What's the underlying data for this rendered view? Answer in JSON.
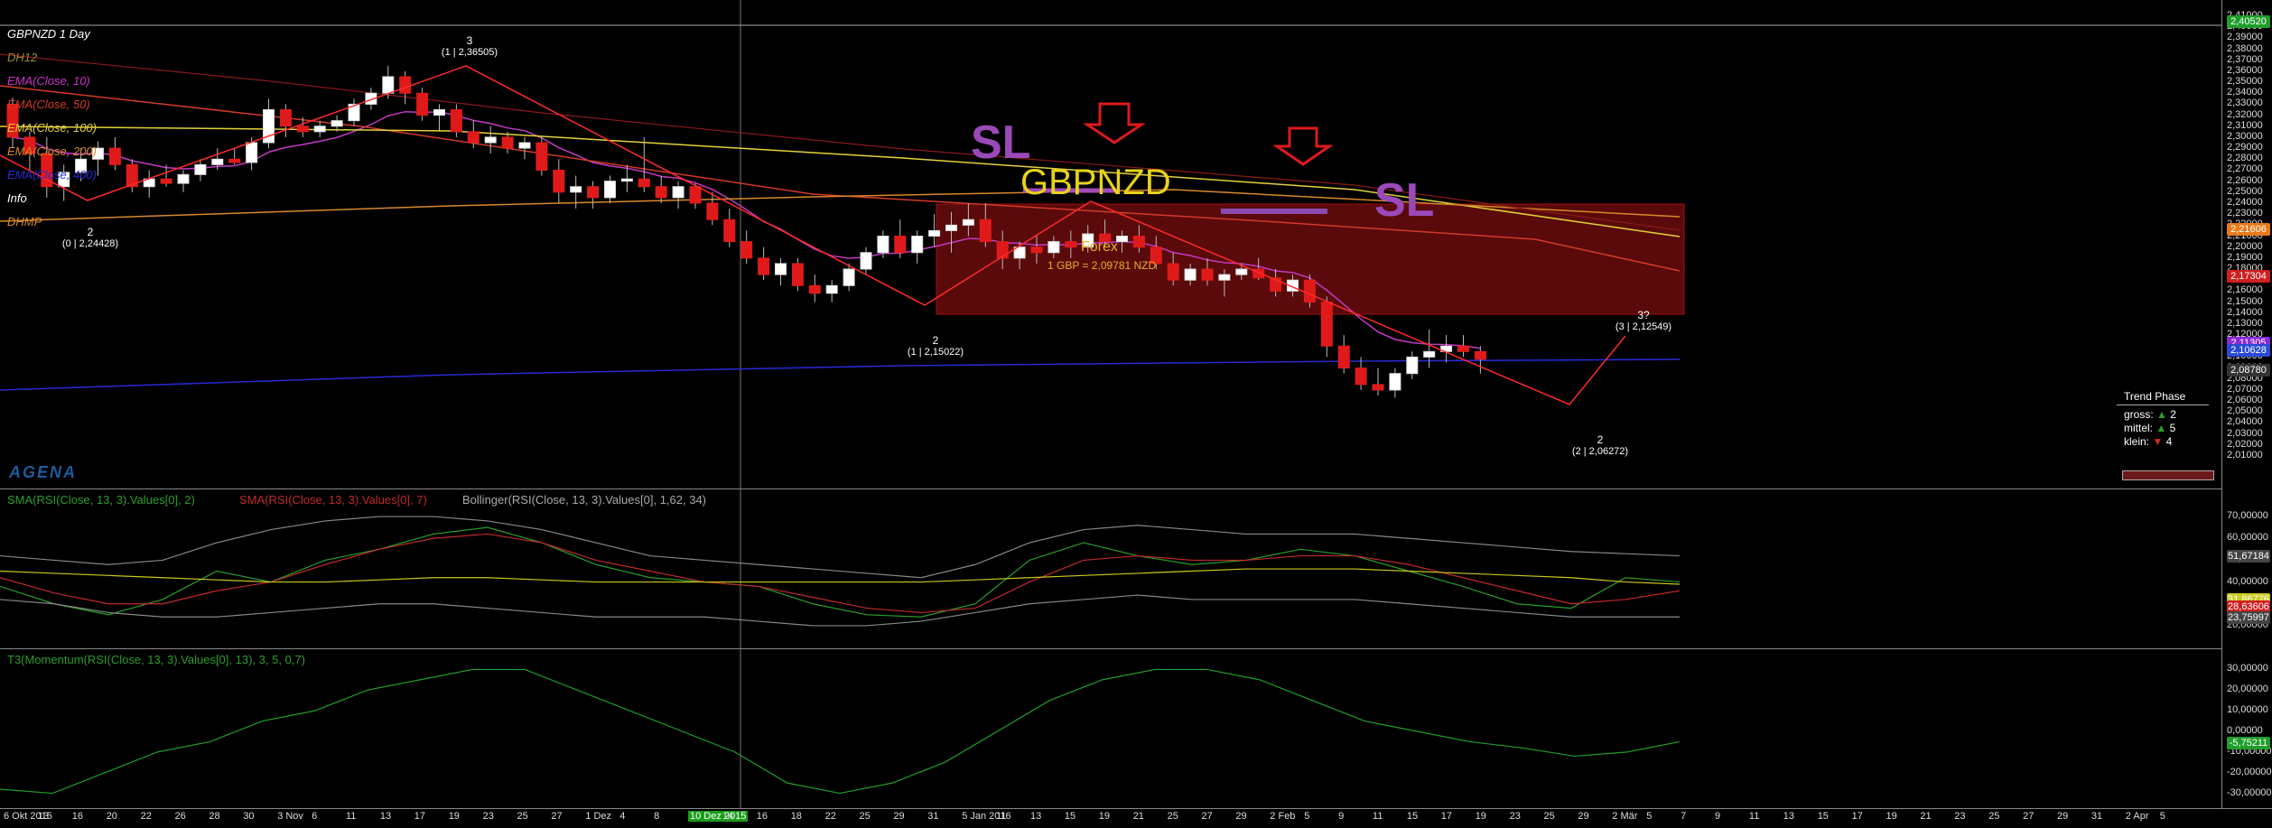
{
  "chart": {
    "symbol_title": "GBPNZD 1 Day",
    "indicators": [
      {
        "label": "DH12",
        "color": "#8f8f2a"
      },
      {
        "label": "EMA(Close, 10)",
        "color": "#cc33cc"
      },
      {
        "label": "EMA(Close, 50)",
        "color": "#d23a2a"
      },
      {
        "label": "EMA(Close, 100)",
        "color": "#e2d23a"
      },
      {
        "label": "EMA(Close, 200)",
        "color": "#d7892a"
      },
      {
        "label": "EMA(Close, 400)",
        "color": "#2a2ad6"
      },
      {
        "label": "Info",
        "color": "#ffffff"
      },
      {
        "label": "DHMP",
        "color": "#d7892a"
      }
    ],
    "annotations": {
      "sl_left": "SL",
      "sl_right": "SL",
      "symbol_big": "GBPNZD",
      "forex_label": "Forex",
      "rate_label": "1 GBP = 2,09781 NZD",
      "dash": "——"
    },
    "waves": [
      {
        "num": "3",
        "detail": "(1 | 2,36505)"
      },
      {
        "num": "2",
        "detail": "(0 | 2,24428)"
      },
      {
        "num": "2",
        "detail": "(1 | 2,15022)"
      },
      {
        "num": "3?",
        "detail": "(3 | 2,12549)"
      },
      {
        "num": "2",
        "detail": "(2 | 2,06272)"
      }
    ],
    "trend_phase": {
      "title": "Trend Phase",
      "gross": "gross:",
      "gross_val": "2",
      "mittel": "mittel:",
      "mittel_val": "5",
      "klein": "klein:",
      "klein_val": "4"
    },
    "logo": "AGENA",
    "price_axis": [
      "2,41000",
      "2,40000",
      "2,39000",
      "2,38000",
      "2,37000",
      "2,36000",
      "2,35000",
      "2,34000",
      "2,33000",
      "2,32000",
      "2,31000",
      "2,30000",
      "2,29000",
      "2,28000",
      "2,27000",
      "2,26000",
      "2,25000",
      "2,24000",
      "2,23000",
      "2,22000",
      "2,21000",
      "2,20000",
      "2,19000",
      "2,18000",
      "2,17000",
      "2,16000",
      "2,15000",
      "2,14000",
      "2,13000",
      "2,12000",
      "2,11000",
      "2,10000",
      "2,09000",
      "2,08000",
      "2,07000",
      "2,06000",
      "2,05000",
      "2,04000",
      "2,03000",
      "2,02000",
      "2,01000"
    ],
    "price_badges": [
      {
        "text": "2,40520",
        "color": "#1f9e2a"
      },
      {
        "text": "2,21606",
        "color": "#e87a1a"
      },
      {
        "text": "2,17304",
        "color": "#d01f1f"
      },
      {
        "text": "2,11305",
        "color": "#8a2ad6"
      },
      {
        "text": "2,10628",
        "color": "#2a4ad6"
      },
      {
        "text": "2,08780",
        "color": "#333333"
      }
    ]
  },
  "rsi_pane": {
    "titles": [
      {
        "label": "SMA(RSI(Close, 13, 3).Values[0], 2)",
        "color": "#2a9e2a"
      },
      {
        "label": "SMA(RSI(Close, 13, 3).Values[0], 7)",
        "color": "#c02a2a"
      },
      {
        "label": "Bollinger(RSI(Close, 13, 3).Values[0], 1,62, 34)",
        "color": "#aaaaaa"
      }
    ],
    "axis": [
      "70,00000",
      "60,00000",
      "50,00000",
      "40,00000",
      "30,00000",
      "20,00000"
    ],
    "badges": [
      {
        "text": "51,67184",
        "color": "#444444"
      },
      {
        "text": "31,86776",
        "color": "#cccc22"
      },
      {
        "text": "28,63606",
        "color": "#d01f1f"
      },
      {
        "text": "23,75997",
        "color": "#444444"
      }
    ]
  },
  "momentum_pane": {
    "title": "T3(Momentum(RSI(Close, 13, 3).Values[0], 13), 3, 5, 0,7)",
    "title_color": "#2a9e2a",
    "axis": [
      "30,00000",
      "20,00000",
      "10,00000",
      "0,00000",
      "-10,00000",
      "-20,00000",
      "-30,00000"
    ],
    "badge": {
      "text": "-5,75211",
      "color": "#1f9e2a"
    }
  },
  "time_axis": {
    "labels": [
      "6 Okt 2015",
      "13",
      "16",
      "20",
      "22",
      "26",
      "28",
      "30",
      "3 Nov",
      "6",
      "11",
      "13",
      "17",
      "19",
      "23",
      "25",
      "27",
      "1 Dez",
      "4",
      "8",
      "10 Dez 2015",
      "14",
      "16",
      "18",
      "22",
      "25",
      "29",
      "31",
      "5 Jan 2016",
      "11",
      "13",
      "15",
      "19",
      "21",
      "25",
      "27",
      "29",
      "2 Feb",
      "5",
      "9",
      "11",
      "15",
      "17",
      "19",
      "23",
      "25",
      "29",
      "2 Mär",
      "5",
      "7",
      "9",
      "11",
      "13",
      "15",
      "17",
      "19",
      "21",
      "23",
      "25",
      "27",
      "29",
      "31",
      "2 Apr",
      "5"
    ],
    "highlight": "10 Dez 2015"
  },
  "candles": [
    {
      "o": 2.33,
      "h": 2.336,
      "l": 2.29,
      "c": 2.3
    },
    {
      "o": 2.3,
      "h": 2.305,
      "l": 2.27,
      "c": 2.285
    },
    {
      "o": 2.285,
      "h": 2.3,
      "l": 2.245,
      "c": 2.255
    },
    {
      "o": 2.255,
      "h": 2.275,
      "l": 2.242,
      "c": 2.268
    },
    {
      "o": 2.268,
      "h": 2.29,
      "l": 2.26,
      "c": 2.28
    },
    {
      "o": 2.28,
      "h": 2.296,
      "l": 2.265,
      "c": 2.29
    },
    {
      "o": 2.29,
      "h": 2.3,
      "l": 2.27,
      "c": 2.275
    },
    {
      "o": 2.275,
      "h": 2.28,
      "l": 2.25,
      "c": 2.255
    },
    {
      "o": 2.255,
      "h": 2.27,
      "l": 2.245,
      "c": 2.262
    },
    {
      "o": 2.262,
      "h": 2.275,
      "l": 2.255,
      "c": 2.258
    },
    {
      "o": 2.258,
      "h": 2.27,
      "l": 2.25,
      "c": 2.266
    },
    {
      "o": 2.266,
      "h": 2.28,
      "l": 2.26,
      "c": 2.275
    },
    {
      "o": 2.275,
      "h": 2.29,
      "l": 2.27,
      "c": 2.28
    },
    {
      "o": 2.28,
      "h": 2.29,
      "l": 2.275,
      "c": 2.277
    },
    {
      "o": 2.277,
      "h": 2.3,
      "l": 2.27,
      "c": 2.295
    },
    {
      "o": 2.295,
      "h": 2.335,
      "l": 2.29,
      "c": 2.325
    },
    {
      "o": 2.325,
      "h": 2.33,
      "l": 2.3,
      "c": 2.31
    },
    {
      "o": 2.31,
      "h": 2.318,
      "l": 2.3,
      "c": 2.305
    },
    {
      "o": 2.305,
      "h": 2.315,
      "l": 2.3,
      "c": 2.31
    },
    {
      "o": 2.31,
      "h": 2.32,
      "l": 2.305,
      "c": 2.315
    },
    {
      "o": 2.315,
      "h": 2.335,
      "l": 2.31,
      "c": 2.33
    },
    {
      "o": 2.33,
      "h": 2.345,
      "l": 2.325,
      "c": 2.34
    },
    {
      "o": 2.34,
      "h": 2.365,
      "l": 2.335,
      "c": 2.355
    },
    {
      "o": 2.355,
      "h": 2.36,
      "l": 2.33,
      "c": 2.34
    },
    {
      "o": 2.34,
      "h": 2.345,
      "l": 2.315,
      "c": 2.32
    },
    {
      "o": 2.32,
      "h": 2.33,
      "l": 2.305,
      "c": 2.325
    },
    {
      "o": 2.325,
      "h": 2.33,
      "l": 2.3,
      "c": 2.305
    },
    {
      "o": 2.305,
      "h": 2.315,
      "l": 2.29,
      "c": 2.295
    },
    {
      "o": 2.295,
      "h": 2.31,
      "l": 2.285,
      "c": 2.3
    },
    {
      "o": 2.3,
      "h": 2.305,
      "l": 2.285,
      "c": 2.29
    },
    {
      "o": 2.29,
      "h": 2.3,
      "l": 2.28,
      "c": 2.295
    },
    {
      "o": 2.295,
      "h": 2.3,
      "l": 2.265,
      "c": 2.27
    },
    {
      "o": 2.27,
      "h": 2.28,
      "l": 2.24,
      "c": 2.25
    },
    {
      "o": 2.25,
      "h": 2.265,
      "l": 2.235,
      "c": 2.255
    },
    {
      "o": 2.255,
      "h": 2.26,
      "l": 2.235,
      "c": 2.245
    },
    {
      "o": 2.245,
      "h": 2.265,
      "l": 2.24,
      "c": 2.26
    },
    {
      "o": 2.26,
      "h": 2.275,
      "l": 2.25,
      "c": 2.262
    },
    {
      "o": 2.262,
      "h": 2.3,
      "l": 2.25,
      "c": 2.255
    },
    {
      "o": 2.255,
      "h": 2.265,
      "l": 2.24,
      "c": 2.245
    },
    {
      "o": 2.245,
      "h": 2.26,
      "l": 2.235,
      "c": 2.255
    },
    {
      "o": 2.255,
      "h": 2.258,
      "l": 2.235,
      "c": 2.24
    },
    {
      "o": 2.24,
      "h": 2.25,
      "l": 2.22,
      "c": 2.225
    },
    {
      "o": 2.225,
      "h": 2.235,
      "l": 2.2,
      "c": 2.205
    },
    {
      "o": 2.205,
      "h": 2.215,
      "l": 2.185,
      "c": 2.19
    },
    {
      "o": 2.19,
      "h": 2.2,
      "l": 2.17,
      "c": 2.175
    },
    {
      "o": 2.175,
      "h": 2.19,
      "l": 2.165,
      "c": 2.185
    },
    {
      "o": 2.185,
      "h": 2.19,
      "l": 2.16,
      "c": 2.165
    },
    {
      "o": 2.165,
      "h": 2.175,
      "l": 2.15,
      "c": 2.158
    },
    {
      "o": 2.158,
      "h": 2.17,
      "l": 2.15,
      "c": 2.165
    },
    {
      "o": 2.165,
      "h": 2.185,
      "l": 2.16,
      "c": 2.18
    },
    {
      "o": 2.18,
      "h": 2.2,
      "l": 2.175,
      "c": 2.195
    },
    {
      "o": 2.195,
      "h": 2.215,
      "l": 2.19,
      "c": 2.21
    },
    {
      "o": 2.21,
      "h": 2.225,
      "l": 2.19,
      "c": 2.195
    },
    {
      "o": 2.195,
      "h": 2.215,
      "l": 2.185,
      "c": 2.21
    },
    {
      "o": 2.21,
      "h": 2.23,
      "l": 2.2,
      "c": 2.215
    },
    {
      "o": 2.215,
      "h": 2.232,
      "l": 2.195,
      "c": 2.22
    },
    {
      "o": 2.22,
      "h": 2.24,
      "l": 2.21,
      "c": 2.225
    },
    {
      "o": 2.225,
      "h": 2.24,
      "l": 2.2,
      "c": 2.205
    },
    {
      "o": 2.205,
      "h": 2.215,
      "l": 2.18,
      "c": 2.19
    },
    {
      "o": 2.19,
      "h": 2.205,
      "l": 2.18,
      "c": 2.2
    },
    {
      "o": 2.2,
      "h": 2.21,
      "l": 2.185,
      "c": 2.195
    },
    {
      "o": 2.195,
      "h": 2.21,
      "l": 2.19,
      "c": 2.205
    },
    {
      "o": 2.205,
      "h": 2.215,
      "l": 2.19,
      "c": 2.2
    },
    {
      "o": 2.2,
      "h": 2.22,
      "l": 2.195,
      "c": 2.212
    },
    {
      "o": 2.212,
      "h": 2.225,
      "l": 2.2,
      "c": 2.205
    },
    {
      "o": 2.205,
      "h": 2.215,
      "l": 2.195,
      "c": 2.21
    },
    {
      "o": 2.21,
      "h": 2.22,
      "l": 2.195,
      "c": 2.2
    },
    {
      "o": 2.2,
      "h": 2.21,
      "l": 2.18,
      "c": 2.185
    },
    {
      "o": 2.185,
      "h": 2.195,
      "l": 2.165,
      "c": 2.17
    },
    {
      "o": 2.17,
      "h": 2.185,
      "l": 2.165,
      "c": 2.18
    },
    {
      "o": 2.18,
      "h": 2.19,
      "l": 2.165,
      "c": 2.17
    },
    {
      "o": 2.17,
      "h": 2.18,
      "l": 2.155,
      "c": 2.175
    },
    {
      "o": 2.175,
      "h": 2.185,
      "l": 2.17,
      "c": 2.18
    },
    {
      "o": 2.18,
      "h": 2.19,
      "l": 2.17,
      "c": 2.172
    },
    {
      "o": 2.172,
      "h": 2.18,
      "l": 2.155,
      "c": 2.16
    },
    {
      "o": 2.16,
      "h": 2.175,
      "l": 2.155,
      "c": 2.17
    },
    {
      "o": 2.17,
      "h": 2.175,
      "l": 2.145,
      "c": 2.15
    },
    {
      "o": 2.15,
      "h": 2.155,
      "l": 2.1,
      "c": 2.11
    },
    {
      "o": 2.11,
      "h": 2.12,
      "l": 2.085,
      "c": 2.09
    },
    {
      "o": 2.09,
      "h": 2.1,
      "l": 2.07,
      "c": 2.075
    },
    {
      "o": 2.075,
      "h": 2.09,
      "l": 2.065,
      "c": 2.07
    },
    {
      "o": 2.07,
      "h": 2.09,
      "l": 2.063,
      "c": 2.085
    },
    {
      "o": 2.085,
      "h": 2.105,
      "l": 2.08,
      "c": 2.1
    },
    {
      "o": 2.1,
      "h": 2.125,
      "l": 2.09,
      "c": 2.105
    },
    {
      "o": 2.105,
      "h": 2.12,
      "l": 2.095,
      "c": 2.11
    },
    {
      "o": 2.11,
      "h": 2.12,
      "l": 2.1,
      "c": 2.105
    },
    {
      "o": 2.105,
      "h": 2.11,
      "l": 2.085,
      "c": 2.098
    }
  ]
}
